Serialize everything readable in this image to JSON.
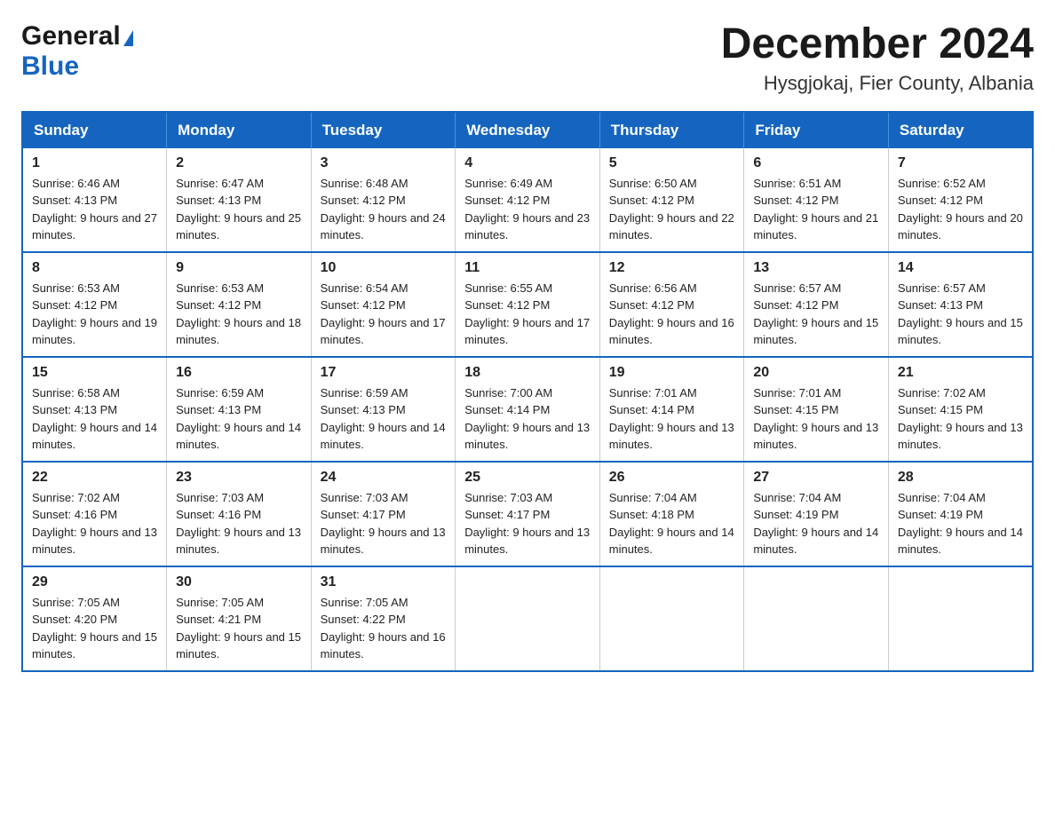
{
  "header": {
    "logo_general": "General",
    "logo_blue": "Blue",
    "month_title": "December 2024",
    "location": "Hysgjokaj, Fier County, Albania"
  },
  "days_of_week": [
    "Sunday",
    "Monday",
    "Tuesday",
    "Wednesday",
    "Thursday",
    "Friday",
    "Saturday"
  ],
  "weeks": [
    [
      {
        "day": "1",
        "sunrise": "Sunrise: 6:46 AM",
        "sunset": "Sunset: 4:13 PM",
        "daylight": "Daylight: 9 hours and 27 minutes."
      },
      {
        "day": "2",
        "sunrise": "Sunrise: 6:47 AM",
        "sunset": "Sunset: 4:13 PM",
        "daylight": "Daylight: 9 hours and 25 minutes."
      },
      {
        "day": "3",
        "sunrise": "Sunrise: 6:48 AM",
        "sunset": "Sunset: 4:12 PM",
        "daylight": "Daylight: 9 hours and 24 minutes."
      },
      {
        "day": "4",
        "sunrise": "Sunrise: 6:49 AM",
        "sunset": "Sunset: 4:12 PM",
        "daylight": "Daylight: 9 hours and 23 minutes."
      },
      {
        "day": "5",
        "sunrise": "Sunrise: 6:50 AM",
        "sunset": "Sunset: 4:12 PM",
        "daylight": "Daylight: 9 hours and 22 minutes."
      },
      {
        "day": "6",
        "sunrise": "Sunrise: 6:51 AM",
        "sunset": "Sunset: 4:12 PM",
        "daylight": "Daylight: 9 hours and 21 minutes."
      },
      {
        "day": "7",
        "sunrise": "Sunrise: 6:52 AM",
        "sunset": "Sunset: 4:12 PM",
        "daylight": "Daylight: 9 hours and 20 minutes."
      }
    ],
    [
      {
        "day": "8",
        "sunrise": "Sunrise: 6:53 AM",
        "sunset": "Sunset: 4:12 PM",
        "daylight": "Daylight: 9 hours and 19 minutes."
      },
      {
        "day": "9",
        "sunrise": "Sunrise: 6:53 AM",
        "sunset": "Sunset: 4:12 PM",
        "daylight": "Daylight: 9 hours and 18 minutes."
      },
      {
        "day": "10",
        "sunrise": "Sunrise: 6:54 AM",
        "sunset": "Sunset: 4:12 PM",
        "daylight": "Daylight: 9 hours and 17 minutes."
      },
      {
        "day": "11",
        "sunrise": "Sunrise: 6:55 AM",
        "sunset": "Sunset: 4:12 PM",
        "daylight": "Daylight: 9 hours and 17 minutes."
      },
      {
        "day": "12",
        "sunrise": "Sunrise: 6:56 AM",
        "sunset": "Sunset: 4:12 PM",
        "daylight": "Daylight: 9 hours and 16 minutes."
      },
      {
        "day": "13",
        "sunrise": "Sunrise: 6:57 AM",
        "sunset": "Sunset: 4:12 PM",
        "daylight": "Daylight: 9 hours and 15 minutes."
      },
      {
        "day": "14",
        "sunrise": "Sunrise: 6:57 AM",
        "sunset": "Sunset: 4:13 PM",
        "daylight": "Daylight: 9 hours and 15 minutes."
      }
    ],
    [
      {
        "day": "15",
        "sunrise": "Sunrise: 6:58 AM",
        "sunset": "Sunset: 4:13 PM",
        "daylight": "Daylight: 9 hours and 14 minutes."
      },
      {
        "day": "16",
        "sunrise": "Sunrise: 6:59 AM",
        "sunset": "Sunset: 4:13 PM",
        "daylight": "Daylight: 9 hours and 14 minutes."
      },
      {
        "day": "17",
        "sunrise": "Sunrise: 6:59 AM",
        "sunset": "Sunset: 4:13 PM",
        "daylight": "Daylight: 9 hours and 14 minutes."
      },
      {
        "day": "18",
        "sunrise": "Sunrise: 7:00 AM",
        "sunset": "Sunset: 4:14 PM",
        "daylight": "Daylight: 9 hours and 13 minutes."
      },
      {
        "day": "19",
        "sunrise": "Sunrise: 7:01 AM",
        "sunset": "Sunset: 4:14 PM",
        "daylight": "Daylight: 9 hours and 13 minutes."
      },
      {
        "day": "20",
        "sunrise": "Sunrise: 7:01 AM",
        "sunset": "Sunset: 4:15 PM",
        "daylight": "Daylight: 9 hours and 13 minutes."
      },
      {
        "day": "21",
        "sunrise": "Sunrise: 7:02 AM",
        "sunset": "Sunset: 4:15 PM",
        "daylight": "Daylight: 9 hours and 13 minutes."
      }
    ],
    [
      {
        "day": "22",
        "sunrise": "Sunrise: 7:02 AM",
        "sunset": "Sunset: 4:16 PM",
        "daylight": "Daylight: 9 hours and 13 minutes."
      },
      {
        "day": "23",
        "sunrise": "Sunrise: 7:03 AM",
        "sunset": "Sunset: 4:16 PM",
        "daylight": "Daylight: 9 hours and 13 minutes."
      },
      {
        "day": "24",
        "sunrise": "Sunrise: 7:03 AM",
        "sunset": "Sunset: 4:17 PM",
        "daylight": "Daylight: 9 hours and 13 minutes."
      },
      {
        "day": "25",
        "sunrise": "Sunrise: 7:03 AM",
        "sunset": "Sunset: 4:17 PM",
        "daylight": "Daylight: 9 hours and 13 minutes."
      },
      {
        "day": "26",
        "sunrise": "Sunrise: 7:04 AM",
        "sunset": "Sunset: 4:18 PM",
        "daylight": "Daylight: 9 hours and 14 minutes."
      },
      {
        "day": "27",
        "sunrise": "Sunrise: 7:04 AM",
        "sunset": "Sunset: 4:19 PM",
        "daylight": "Daylight: 9 hours and 14 minutes."
      },
      {
        "day": "28",
        "sunrise": "Sunrise: 7:04 AM",
        "sunset": "Sunset: 4:19 PM",
        "daylight": "Daylight: 9 hours and 14 minutes."
      }
    ],
    [
      {
        "day": "29",
        "sunrise": "Sunrise: 7:05 AM",
        "sunset": "Sunset: 4:20 PM",
        "daylight": "Daylight: 9 hours and 15 minutes."
      },
      {
        "day": "30",
        "sunrise": "Sunrise: 7:05 AM",
        "sunset": "Sunset: 4:21 PM",
        "daylight": "Daylight: 9 hours and 15 minutes."
      },
      {
        "day": "31",
        "sunrise": "Sunrise: 7:05 AM",
        "sunset": "Sunset: 4:22 PM",
        "daylight": "Daylight: 9 hours and 16 minutes."
      },
      null,
      null,
      null,
      null
    ]
  ]
}
